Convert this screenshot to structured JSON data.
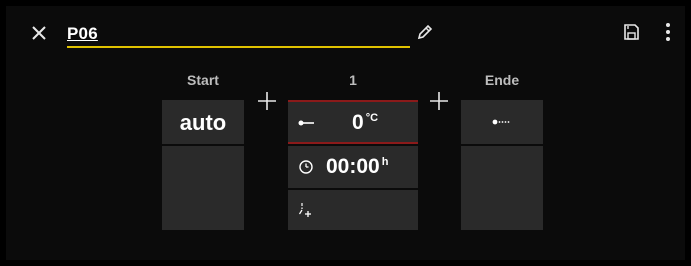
{
  "header": {
    "title": "P06"
  },
  "columns": {
    "start": {
      "label": "Start",
      "value": "auto"
    },
    "step1": {
      "label": "1",
      "temperature": {
        "value": "0",
        "unit": "°C"
      },
      "time": {
        "value": "00:00",
        "unit": "h"
      }
    },
    "end": {
      "label": "Ende"
    }
  },
  "icons": {
    "close": "close-icon",
    "edit": "pencil-icon",
    "save": "save-icon",
    "menu": "more-vertical-icon",
    "add": "plus-icon",
    "ramp": "ramp-line-icon",
    "clock": "clock-icon",
    "add_step": "add-step-icon",
    "end_line": "dotted-line-icon"
  },
  "colors": {
    "accent_underline": "#e0c200",
    "active_border": "#8b1a1a",
    "cell_bg": "#2a2a2a",
    "background": "#0b0b0b"
  }
}
